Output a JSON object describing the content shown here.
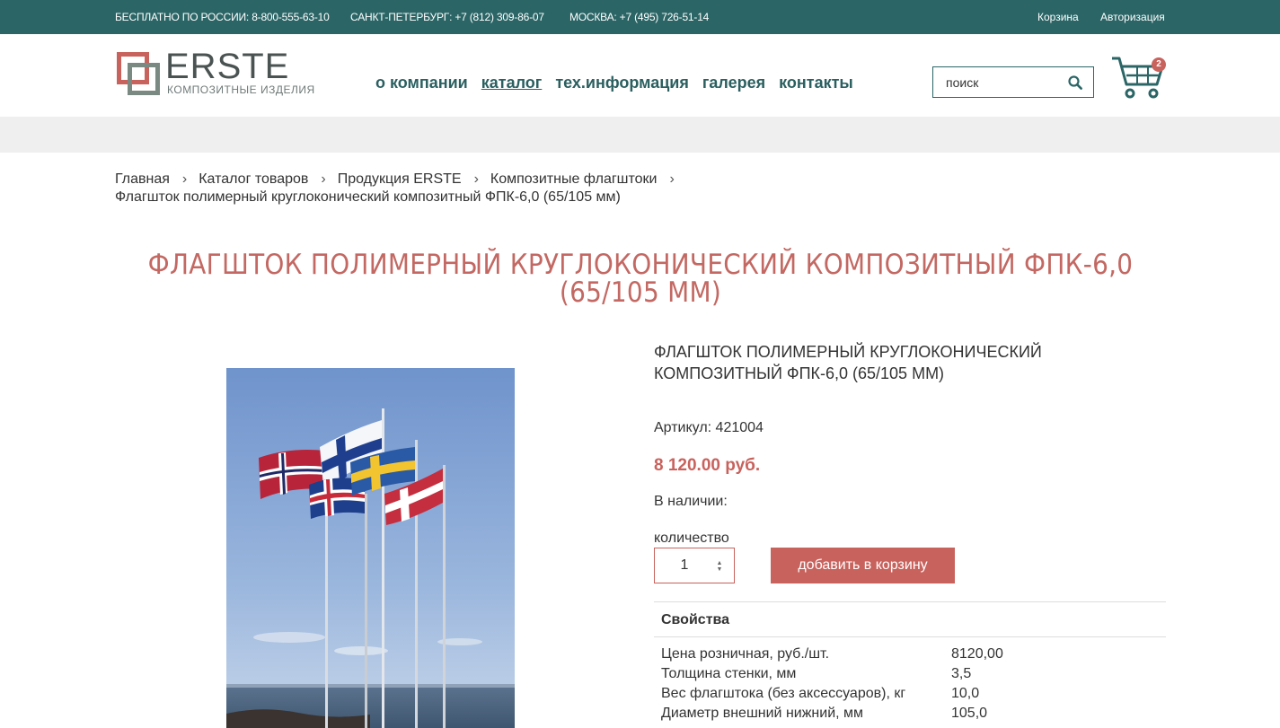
{
  "topbar": {
    "phone_russia": "БЕСПЛАТНО ПО РОССИИ: 8-800-555-63-10",
    "phone_spb": "САНКТ-ПЕТЕРБУРГ: +7 (812) 309-86-07",
    "phone_msk": "МОСКВА: +7 (495) 726-51-14",
    "cart_link": "Корзина",
    "login_link": "Авторизация",
    "bg_color": "#2b6566"
  },
  "logo": {
    "name": "ERSTE",
    "subtitle": "КОМПОЗИТНЫЕ ИЗДЕЛИЯ"
  },
  "nav": {
    "items": [
      {
        "label": "о компании",
        "active": false
      },
      {
        "label": "каталог",
        "active": true
      },
      {
        "label": "тех.информация",
        "active": false
      },
      {
        "label": "галерея",
        "active": false
      },
      {
        "label": "контакты",
        "active": false
      }
    ]
  },
  "search": {
    "placeholder": "поиск",
    "icon": "search-icon"
  },
  "cart": {
    "icon": "cart-icon",
    "count": "2"
  },
  "breadcrumb": {
    "items": [
      "Главная",
      "Каталог товаров",
      "Продукция ERSTE",
      "Композитные флагштоки"
    ],
    "current": "Флагшток полимерный круглоконический композитный ФПК-6,0 (65/105 мм)"
  },
  "page_title": "Флагшток полимерный круглоконический композитный ФПК-6,0 (65/105 мм)",
  "product": {
    "name": "ФЛАГШТОК ПОЛИМЕРНЫЙ КРУГЛОКОНИЧЕСКИЙ КОМПОЗИТНЫЙ ФПК-6,0 (65/105 ММ)",
    "sku": "Артикул: 421004",
    "price": "8 120.00 руб.",
    "stock": "В наличии:",
    "qty_label": "количество",
    "qty_value": "1",
    "add_button": "добавить в корзину",
    "accent_color": "#c8625d"
  },
  "properties": {
    "header": "Свойства",
    "rows": [
      {
        "key": "Цена розничная, руб./шт.",
        "value": "8120,00"
      },
      {
        "key": "Толщина стенки, мм",
        "value": "3,5"
      },
      {
        "key": "Вес флагштока (без аксессуаров), кг",
        "value": "10,0"
      },
      {
        "key": "Диаметр внешний нижний, мм",
        "value": "105,0"
      }
    ]
  }
}
